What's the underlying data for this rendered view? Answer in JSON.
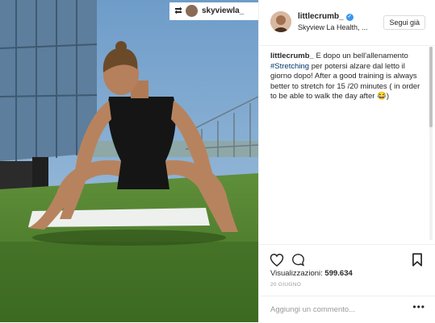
{
  "repost": {
    "username": "skyviewla_"
  },
  "header": {
    "username": "littlecrumb_",
    "location": "Skyview La Health, ...",
    "follow_label": "Segui già"
  },
  "caption": {
    "username": "littlecrumb_",
    "text_before_tag": " E dopo un bell'allenamento ",
    "hashtag": "#Stretching",
    "text_after_tag": " per potersi alzare dal letto il giorno dopo! After a good training is always better to stretch for 15 /20 minutes ( in order to be able to walk the day after 😂)"
  },
  "stats": {
    "likes_label": "Visualizzazioni:",
    "likes_value": "599.634"
  },
  "date": "20 GIUGNO",
  "comment": {
    "placeholder": "Aggiungi un commento...",
    "more": "•••"
  },
  "icons": [
    "repost-icon",
    "verified-icon",
    "heart-icon",
    "comment-icon",
    "bookmark-icon"
  ],
  "colors": {
    "accent": "#3897f0",
    "hashtag": "#003569",
    "border": "#efefef",
    "muted": "#999999"
  }
}
